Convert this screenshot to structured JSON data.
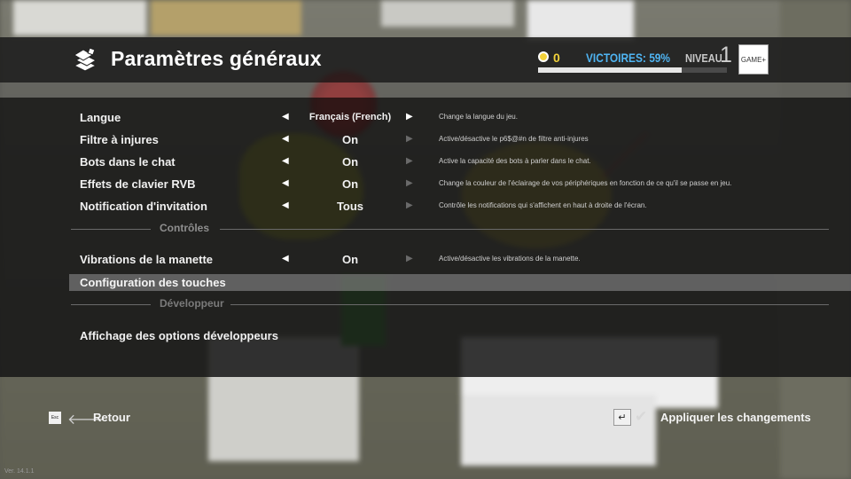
{
  "header": {
    "title": "Paramètres généraux",
    "coins": "0",
    "victories": "VICTOIRES: 59%",
    "level_label": "NIVEAU",
    "level": "1",
    "xp_progress": 0.76,
    "logo_text": "GAME+"
  },
  "settings": [
    {
      "label": "Langue",
      "value": "Français (French)",
      "desc": "Change la langue du jeu.",
      "right_enabled": true
    },
    {
      "label": "Filtre à injures",
      "value": "On",
      "desc": "Active/désactive le p6$@#n de filtre anti-injures",
      "right_enabled": false
    },
    {
      "label": "Bots dans le chat",
      "value": "On",
      "desc": "Active la capacité des bots à parler dans le chat.",
      "right_enabled": false
    },
    {
      "label": "Effets de clavier RVB",
      "value": "On",
      "desc": "Change la couleur de l'éclairage de vos périphériques en fonction de ce qu'il se passe en jeu.",
      "right_enabled": false
    },
    {
      "label": "Notification d'invitation",
      "value": "Tous",
      "desc": "Contrôle les notifications qui s'affichent en haut à droite de l'écran.",
      "right_enabled": false
    }
  ],
  "controls_section": "Contrôles",
  "controller_vibration": {
    "label": "Vibrations de la manette",
    "value": "On",
    "desc": "Active/désactive les vibrations de la manette."
  },
  "key_config": "Configuration des touches",
  "developer_section": "Développeur",
  "dev_options": "Affichage des options développeurs",
  "footer": {
    "esc_key": "Esc",
    "back": "Retour",
    "apply": "Appliquer les changements"
  },
  "version": "Ver. 14.1.1",
  "colors": {
    "coins": "#f2d23a",
    "victories": "#4fb4f2"
  }
}
